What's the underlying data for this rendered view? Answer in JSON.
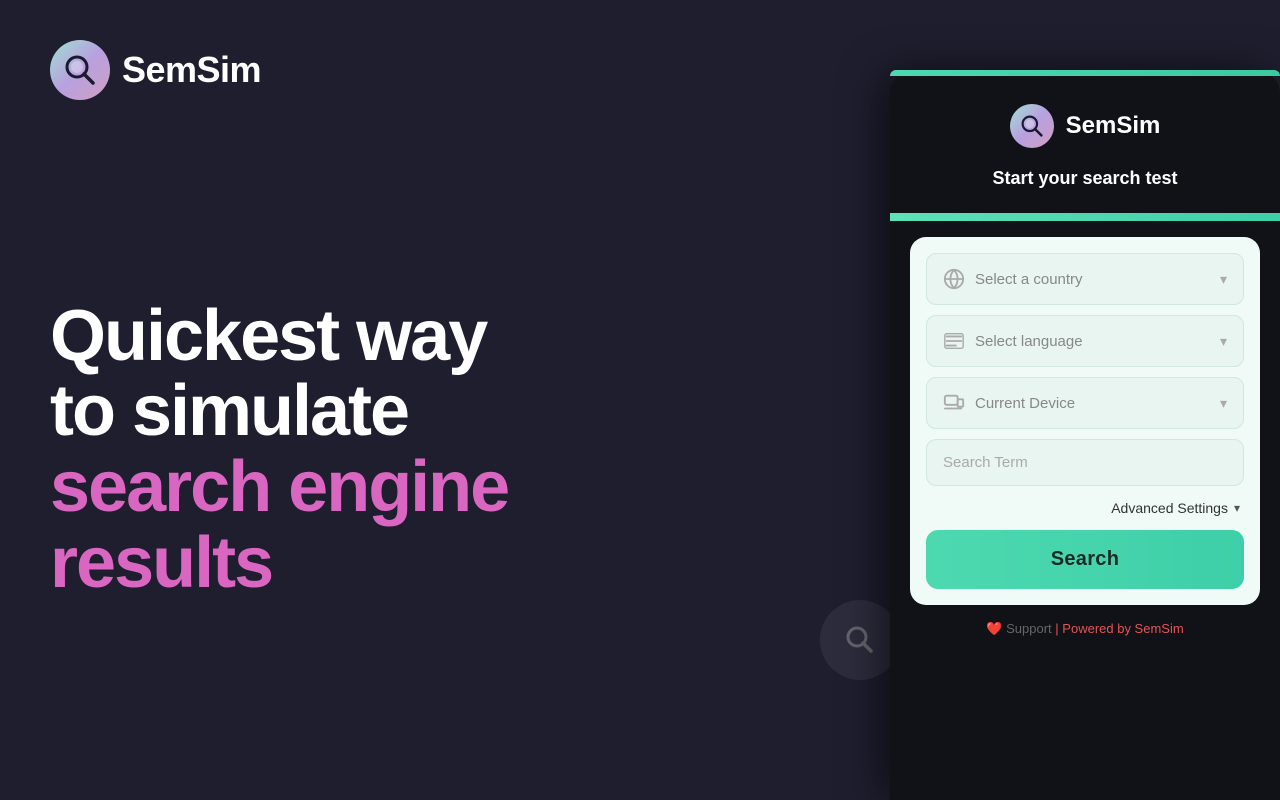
{
  "brand": {
    "name": "SemSim"
  },
  "hero": {
    "line1": "Quickest way",
    "line2": "to simulate",
    "line3": "search engine",
    "line4": "results"
  },
  "card": {
    "subtitle": "Start your search test",
    "country_placeholder": "Select a country",
    "language_placeholder": "Select language",
    "device_placeholder": "Current Device",
    "search_term_placeholder": "Search Term",
    "advanced_settings_label": "Advanced Settings",
    "search_button_label": "Search",
    "footer_heart": "❤️",
    "footer_support": "Support",
    "footer_separator": "|",
    "footer_powered": "Powered by SemSim"
  },
  "icons": {
    "search": "🔍",
    "globe": "🌐",
    "translate": "🔤",
    "device": "💻",
    "chevron_down": "▾"
  }
}
